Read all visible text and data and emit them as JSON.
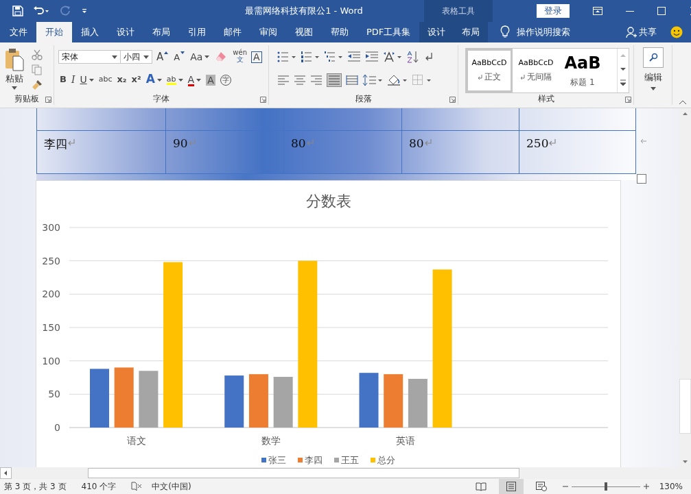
{
  "window": {
    "title": "最需网络科技有限公1  -  Word",
    "context_label": "表格工具",
    "login": "登录"
  },
  "tabs": [
    {
      "label": "文件",
      "selected": false,
      "context": false
    },
    {
      "label": "开始",
      "selected": true,
      "context": false
    },
    {
      "label": "插入",
      "selected": false,
      "context": false
    },
    {
      "label": "设计",
      "selected": false,
      "context": false
    },
    {
      "label": "布局",
      "selected": false,
      "context": false
    },
    {
      "label": "引用",
      "selected": false,
      "context": false
    },
    {
      "label": "邮件",
      "selected": false,
      "context": false
    },
    {
      "label": "审阅",
      "selected": false,
      "context": false
    },
    {
      "label": "视图",
      "selected": false,
      "context": false
    },
    {
      "label": "帮助",
      "selected": false,
      "context": false
    },
    {
      "label": "PDF工具集",
      "selected": false,
      "context": false
    },
    {
      "label": "设计",
      "selected": false,
      "context": true
    },
    {
      "label": "布局",
      "selected": false,
      "context": true
    }
  ],
  "tell_me": "操作说明搜索",
  "share": "共享",
  "clipboard": {
    "paste": "粘贴",
    "group": "剪贴板"
  },
  "font": {
    "name": "宋体",
    "size": "小四",
    "group": "字体",
    "row1": [
      {
        "kind": "grow",
        "label": "A"
      },
      {
        "kind": "shrink",
        "label": "A"
      },
      {
        "kind": "case",
        "label": "Aa"
      },
      {
        "kind": "clear"
      },
      {
        "kind": "phonetic",
        "label": "wén",
        "sub": "文"
      },
      {
        "kind": "border",
        "label": "A"
      }
    ],
    "row2": [
      {
        "kind": "bold",
        "label": "B"
      },
      {
        "kind": "italic",
        "label": "I"
      },
      {
        "kind": "underline",
        "label": "U"
      },
      {
        "kind": "strike",
        "label": "abc"
      },
      {
        "kind": "subscript",
        "label": "x₂"
      },
      {
        "kind": "superscript",
        "label": "x²"
      },
      {
        "kind": "effects",
        "label": "A"
      },
      {
        "kind": "highlight",
        "label": "ab"
      },
      {
        "kind": "color",
        "label": "A"
      },
      {
        "kind": "shade",
        "label": "A"
      },
      {
        "kind": "enclose",
        "label": "字"
      }
    ]
  },
  "paragraph": {
    "group": "段落"
  },
  "styles": {
    "group": "样式",
    "items": [
      {
        "preview": "AaBbCcD",
        "name": "正文",
        "selected": true,
        "kind": "normal"
      },
      {
        "preview": "AaBbCcD",
        "name": "无间隔",
        "selected": false,
        "kind": "normal"
      },
      {
        "preview": "AaB",
        "name": "标题 1",
        "selected": false,
        "kind": "heading"
      }
    ]
  },
  "editing": {
    "label": "编辑"
  },
  "table": {
    "rows": [
      [
        "李四",
        "90",
        "80",
        "80",
        "250"
      ]
    ]
  },
  "chart": {
    "chart_data": {
      "type": "bar",
      "title": "分数表",
      "categories": [
        "语文",
        "数学",
        "英语"
      ],
      "series": [
        {
          "name": "张三",
          "color": "#4472c4",
          "values": [
            88,
            78,
            82
          ]
        },
        {
          "name": "李四",
          "color": "#ed7d31",
          "values": [
            90,
            80,
            80
          ]
        },
        {
          "name": "王五",
          "color": "#a5a5a5",
          "values": [
            85,
            76,
            73
          ]
        },
        {
          "name": "总分",
          "color": "#ffc000",
          "values": [
            248,
            250,
            237
          ]
        }
      ],
      "ylim": [
        0,
        300
      ],
      "yticks": [
        0,
        50,
        100,
        150,
        200,
        250,
        300
      ],
      "grid": true,
      "legend": true
    }
  },
  "status_bar": {
    "page": "第 3 页，共 3 页",
    "words": "410 个字",
    "language": "中文(中国)",
    "zoom": "130%",
    "views": [
      {
        "kind": "read",
        "selected": false
      },
      {
        "kind": "print",
        "selected": true
      },
      {
        "kind": "web",
        "selected": false
      }
    ],
    "zoom_slider": {
      "level": 0.5
    }
  }
}
